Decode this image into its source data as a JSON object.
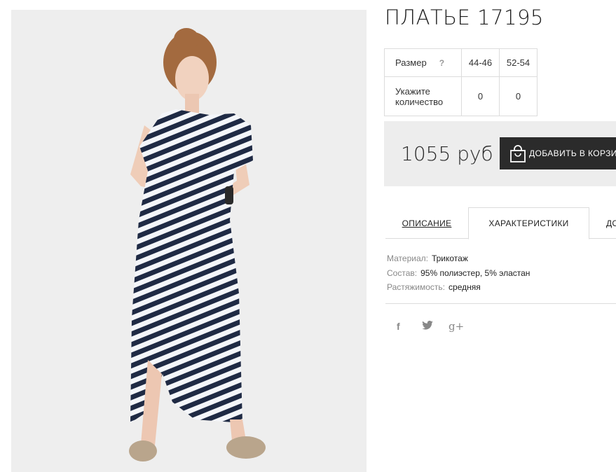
{
  "product": {
    "title": "ПЛАТЬЕ 17195"
  },
  "size_table": {
    "size_label": "Размер",
    "help": "?",
    "sizes": [
      "44-46",
      "52-54"
    ],
    "qty_label": "Укажите количество",
    "quantities": [
      "0",
      "0"
    ]
  },
  "purchase": {
    "price": "1055 руб",
    "add_to_cart": "ДОБАВИТЬ В КОРЗИНУ"
  },
  "tabs": [
    {
      "label": "ОПИСАНИЕ"
    },
    {
      "label": "ХАРАКТЕРИСТИКИ",
      "active": true
    },
    {
      "label": "ДОСТАВКА"
    }
  ],
  "characteristics": [
    {
      "key": "Материал:",
      "value": "Трикотаж"
    },
    {
      "key": "Состав:",
      "value": "95% полиэстер, 5% эластан"
    },
    {
      "key": "Растяжимость:",
      "value": "средняя"
    }
  ],
  "social": {
    "facebook": "f",
    "twitter": "🐦",
    "googleplus": "g+"
  },
  "colors": {
    "button_bg": "#2b2b2b",
    "price_box_bg": "#ededed",
    "photo_bg": "#eeeeee",
    "stripe_dark": "#1f2a44"
  }
}
